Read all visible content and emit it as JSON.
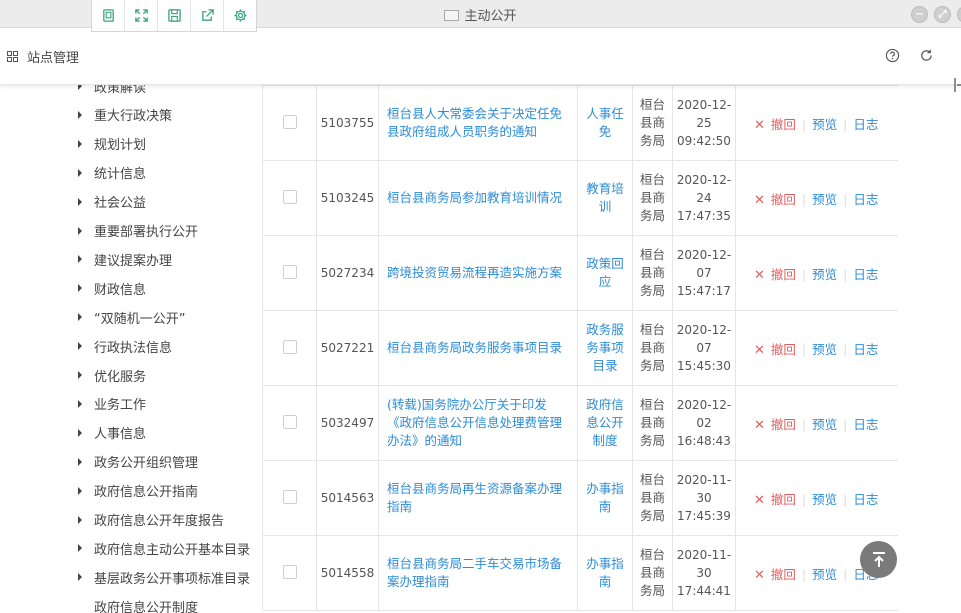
{
  "window": {
    "title": "主动公开"
  },
  "header": {
    "title": "站点管理"
  },
  "sidebar": {
    "items": [
      {
        "label": "政策解读",
        "arrow": true
      },
      {
        "label": "重大行政决策",
        "arrow": true
      },
      {
        "label": "规划计划",
        "arrow": true
      },
      {
        "label": "统计信息",
        "arrow": true
      },
      {
        "label": "社会公益",
        "arrow": true
      },
      {
        "label": "重要部署执行公开",
        "arrow": true
      },
      {
        "label": "建议提案办理",
        "arrow": true
      },
      {
        "label": "财政信息",
        "arrow": true
      },
      {
        "label": "“双随机一公开”",
        "arrow": true
      },
      {
        "label": "行政执法信息",
        "arrow": true
      },
      {
        "label": "优化服务",
        "arrow": true
      },
      {
        "label": "业务工作",
        "arrow": true
      },
      {
        "label": "人事信息",
        "arrow": true
      },
      {
        "label": "政务公开组织管理",
        "arrow": true
      },
      {
        "label": "政府信息公开指南",
        "arrow": true
      },
      {
        "label": "政府信息公开年度报告",
        "arrow": true
      },
      {
        "label": "政府信息主动公开基本目录",
        "arrow": true
      },
      {
        "label": "基层政务公开事项标准目录",
        "arrow": true
      },
      {
        "label": "政府信息公开制度",
        "arrow": false
      }
    ]
  },
  "actions": {
    "undo": "撤回",
    "preview": "预览",
    "log": "日志"
  },
  "table": {
    "rows": [
      {
        "id": "5103755",
        "title": "桓台县人大常委会关于决定任免县政府组成人员职务的通知",
        "category": "人事任免",
        "dept": "桓台县商务局",
        "date": "2020-12-25",
        "time": "09:42:50"
      },
      {
        "id": "5103245",
        "title": "桓台县商务局参加教育培训情况",
        "category": "教育培训",
        "dept": "桓台县商务局",
        "date": "2020-12-24",
        "time": "17:47:35"
      },
      {
        "id": "5027234",
        "title": "跨境投资贸易流程再造实施方案",
        "category": "政策回应",
        "dept": "桓台县商务局",
        "date": "2020-12-07",
        "time": "15:47:17"
      },
      {
        "id": "5027221",
        "title": "桓台县商务局政务服务事项目录",
        "category": "政务服务事项目录",
        "dept": "桓台县商务局",
        "date": "2020-12-07",
        "time": "15:45:30"
      },
      {
        "id": "5032497",
        "title": "(转载)国务院办公厅关于印发《政府信息公开信息处理费管理办法》的通知",
        "category": "政府信息公开制度",
        "dept": "桓台县商务局",
        "date": "2020-12-02",
        "time": "16:48:43"
      },
      {
        "id": "5014563",
        "title": "桓台县商务局再生资源备案办理指南",
        "category": "办事指南",
        "dept": "桓台县商务局",
        "date": "2020-11-30",
        "time": "17:45:39"
      },
      {
        "id": "5014558",
        "title": "桓台县商务局二手车交易市场备案办理指南",
        "category": "办事指南",
        "dept": "桓台县商务局",
        "date": "2020-11-30",
        "time": "17:44:41"
      }
    ]
  },
  "colors": {
    "link": "#2d8cd6",
    "danger": "#e06060",
    "border": "#e6e6e6",
    "icon_green": "#3aa37b"
  }
}
